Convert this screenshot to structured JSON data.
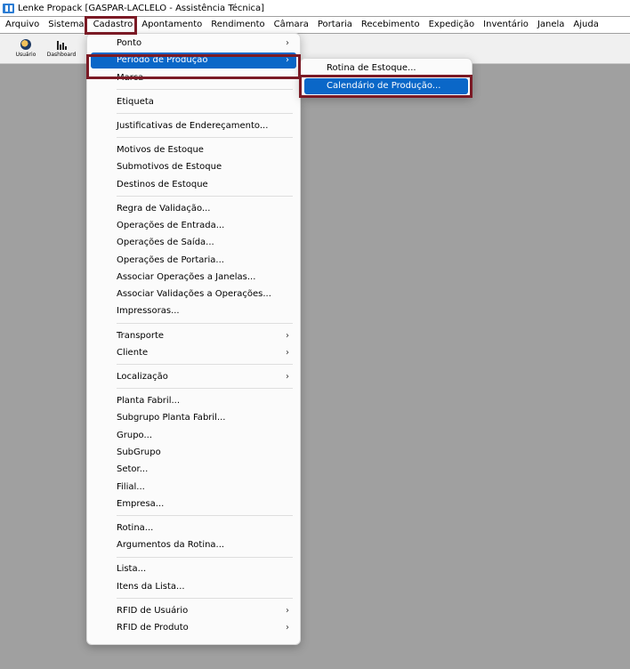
{
  "window": {
    "title": "Lenke Propack [GASPAR-LACLELO - Assistência Técnica]"
  },
  "menubar": [
    "Arquivo",
    "Sistema",
    "Cadastro",
    "Apontamento",
    "Rendimento",
    "Câmara",
    "Portaria",
    "Recebimento",
    "Expedição",
    "Inventário",
    "Janela",
    "Ajuda"
  ],
  "toolbar": {
    "user_label": "Usuário",
    "dashboard_label": "Dashboard"
  },
  "cadastro_menu": [
    {
      "label": "Ponto",
      "sub": true
    },
    {
      "label": "Período de Produção",
      "sub": true,
      "selected": true
    },
    {
      "label": "Marca"
    },
    {
      "sep": true
    },
    {
      "label": "Etiqueta"
    },
    {
      "sep": true
    },
    {
      "label": "Justificativas de Endereçamento..."
    },
    {
      "sep": true
    },
    {
      "label": "Motivos de Estoque"
    },
    {
      "label": "Submotivos de Estoque"
    },
    {
      "label": "Destinos de Estoque"
    },
    {
      "sep": true
    },
    {
      "label": "Regra de Validação..."
    },
    {
      "label": "Operações de Entrada..."
    },
    {
      "label": "Operações de Saída..."
    },
    {
      "label": "Operações de Portaria..."
    },
    {
      "label": "Associar Operações a Janelas..."
    },
    {
      "label": "Associar Validações a Operações..."
    },
    {
      "label": "Impressoras..."
    },
    {
      "sep": true
    },
    {
      "label": "Transporte",
      "sub": true
    },
    {
      "label": "Cliente",
      "sub": true
    },
    {
      "sep": true
    },
    {
      "label": "Localização",
      "sub": true
    },
    {
      "sep": true
    },
    {
      "label": "Planta Fabril..."
    },
    {
      "label": "Subgrupo Planta Fabril..."
    },
    {
      "label": "Grupo..."
    },
    {
      "label": "SubGrupo"
    },
    {
      "label": "Setor..."
    },
    {
      "label": "Filial..."
    },
    {
      "label": "Empresa..."
    },
    {
      "sep": true
    },
    {
      "label": "Rotina..."
    },
    {
      "label": "Argumentos da Rotina..."
    },
    {
      "sep": true
    },
    {
      "label": "Lista..."
    },
    {
      "label": "Itens da Lista..."
    },
    {
      "sep": true
    },
    {
      "label": "RFID de Usuário",
      "sub": true
    },
    {
      "label": "RFID de Produto",
      "sub": true
    }
  ],
  "periodo_submenu": [
    {
      "label": "Rotina de Estoque..."
    },
    {
      "label": "Calendário de Produção...",
      "selected": true
    }
  ],
  "colors": {
    "highlight_border": "#7b1a25",
    "selection": "#0a67c8",
    "workspace": "#a0a0a0"
  }
}
